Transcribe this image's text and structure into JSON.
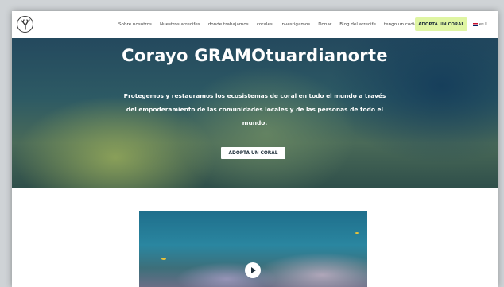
{
  "header": {
    "nav": [
      "Sobre nosotros",
      "Nuestros arrecifes",
      "donde trabajamos",
      "corales",
      "Investigamos",
      "Donar",
      "Blog del arrecife",
      "tengo un codigo de regalo"
    ],
    "adopt_label": "ADOPTA UN CORAL",
    "lang_label": "es L"
  },
  "hero": {
    "title": "Corayo GRAMOtuardianorte",
    "text": "Protegemos y restauramos los ecosistemas de coral en todo el mundo a través del empoderamiento de las comunidades locales y de las personas de todo el mundo.",
    "button_label": "ADOPTA UN CORAL"
  },
  "colors": {
    "accent": "#dff5a3",
    "dark": "#1e2f3a"
  },
  "icons": {
    "logo": "coral-logo-icon",
    "play": "play-icon",
    "flag": "uk-flag-icon"
  }
}
